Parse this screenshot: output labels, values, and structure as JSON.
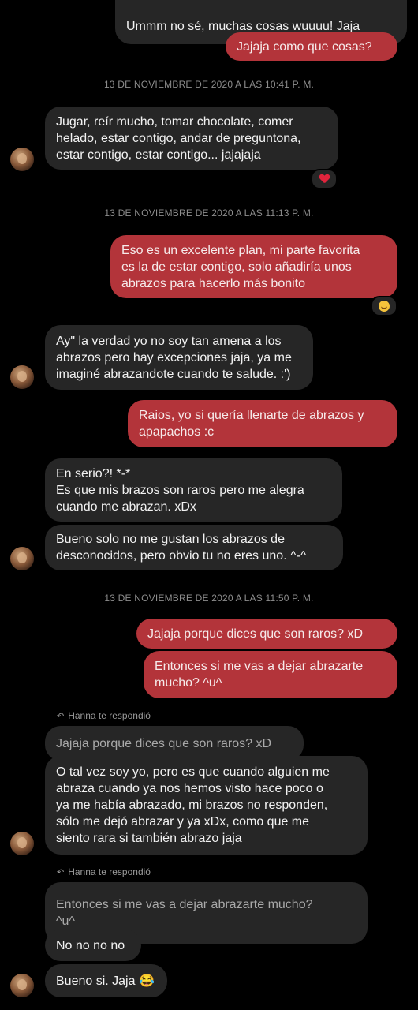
{
  "messages": {
    "m0": "Ummm no sé, muchas cosas wuuuu! Jaja",
    "m1": "Jajaja como que cosas?",
    "m2": "Jugar, reír mucho, tomar chocolate, comer\nhelado, estar contigo, andar de preguntona,\nestar contigo, estar contigo... jajajaja",
    "m3": "Eso es un excelente plan, mi parte favorita\nes la de estar contigo, solo añadiría unos\nabrazos para hacerlo más bonito",
    "m4": "Ay\" la verdad yo no soy tan amena a los\nabrazos pero hay excepciones jaja, ya me\nimaginé abrazandote  cuando te salude.  :')",
    "m5": "Raios, yo si quería llenarte de abrazos y\napapachos :c",
    "m6": "En serio?! *-*\nEs que mis brazos son raros pero me alegra\ncuando me abrazan. xDx",
    "m7": "Bueno solo no me gustan los abrazos de\ndesconocidos, pero obvio tu no eres uno. ^-^",
    "m8": "Jajaja porque dices que son raros? xD",
    "m9": "Entonces si me vas a dejar abrazarte\nmucho? ^u^",
    "q1": "Jajaja porque dices que son raros? xD",
    "m10": "O tal vez soy yo, pero es que cuando alguien me\nabraza cuando ya nos hemos visto hace poco o\nya me había abrazado, mi brazos no responden,\nsólo me dejó abrazar y ya xDx, como que me\nsiento rara si también abrazo jaja",
    "q2": "Entonces si me vas a dejar abrazarte mucho?\n^u^",
    "m11": "No no no no",
    "m12": "Bueno si. Jaja 😂"
  },
  "timestamps": {
    "t1": "13 DE NOVIEMBRE DE 2020 A LAS 10:41 P. M.",
    "t2": "13 DE NOVIEMBRE DE 2020 A LAS 11:13 P. M.",
    "t3": "13 DE NOVIEMBRE DE 2020 A LAS 11:50 P. M."
  },
  "reply_labels": {
    "r1": "Hanna te respondió",
    "r2": "Hanna te respondió"
  },
  "reactions": {
    "r_heart": "heart-emoji",
    "r_smile": "smiling-emoji"
  },
  "colors": {
    "background": "#000000",
    "outgoing_bubble": "#b3343a",
    "incoming_bubble": "#262626",
    "timestamp_text": "#8d8d8d"
  }
}
